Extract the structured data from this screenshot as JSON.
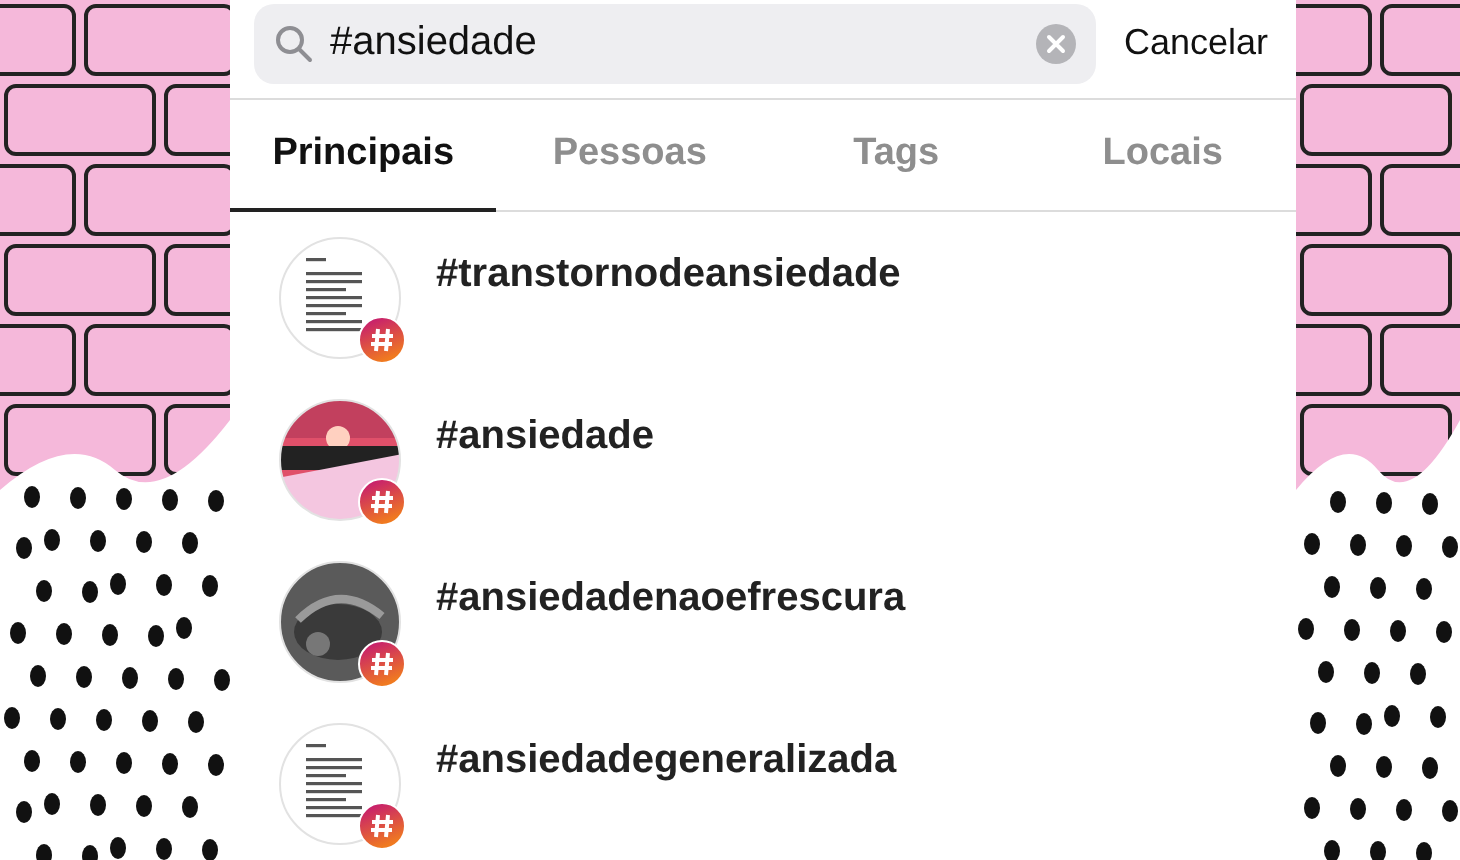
{
  "search": {
    "value": "#ansiedade",
    "cancel": "Cancelar"
  },
  "tabs": [
    {
      "label": "Principais",
      "selected": true
    },
    {
      "label": "Pessoas",
      "selected": false
    },
    {
      "label": "Tags",
      "selected": false
    },
    {
      "label": "Locais",
      "selected": false
    }
  ],
  "results": [
    {
      "tag": "#transtornodeansiedade"
    },
    {
      "tag": "#ansiedade"
    },
    {
      "tag": "#ansiedadenaoefrescura"
    },
    {
      "tag": "#ansiedadegeneralizada"
    }
  ]
}
